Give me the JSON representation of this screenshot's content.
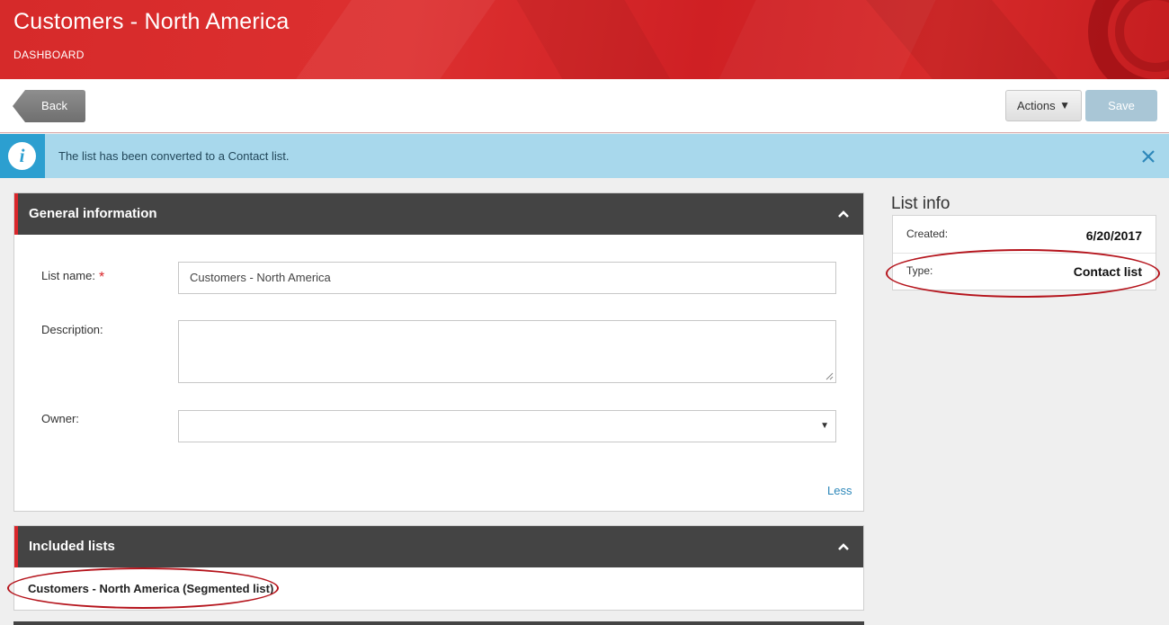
{
  "header": {
    "title": "Customers - North America",
    "breadcrumb": "DASHBOARD"
  },
  "toolbar": {
    "back_label": "Back",
    "actions_label": "Actions",
    "save_label": "Save"
  },
  "alert": {
    "message": "The list has been converted to a Contact list.",
    "icon": "info-icon",
    "close_icon": "close-icon"
  },
  "general_panel": {
    "title": "General information",
    "fields": {
      "list_name_label": "List name:",
      "list_name_value": "Customers - North America",
      "required_mark": "*",
      "description_label": "Description:",
      "description_value": "",
      "owner_label": "Owner:",
      "owner_value": ""
    },
    "less_link": "Less"
  },
  "included_panel": {
    "title": "Included lists",
    "items": [
      "Customers - North America (Segmented list)"
    ]
  },
  "list_info": {
    "title": "List info",
    "created_label": "Created:",
    "created_value": "6/20/2017",
    "type_label": "Type:",
    "type_value": "Contact list"
  },
  "colors": {
    "brand_red": "#d9262b",
    "panel_header": "#444444",
    "alert_bg": "#a8d8ec",
    "alert_icon_bg": "#2c9fd0",
    "link": "#2c87b9",
    "highlight": "#b5141c"
  }
}
